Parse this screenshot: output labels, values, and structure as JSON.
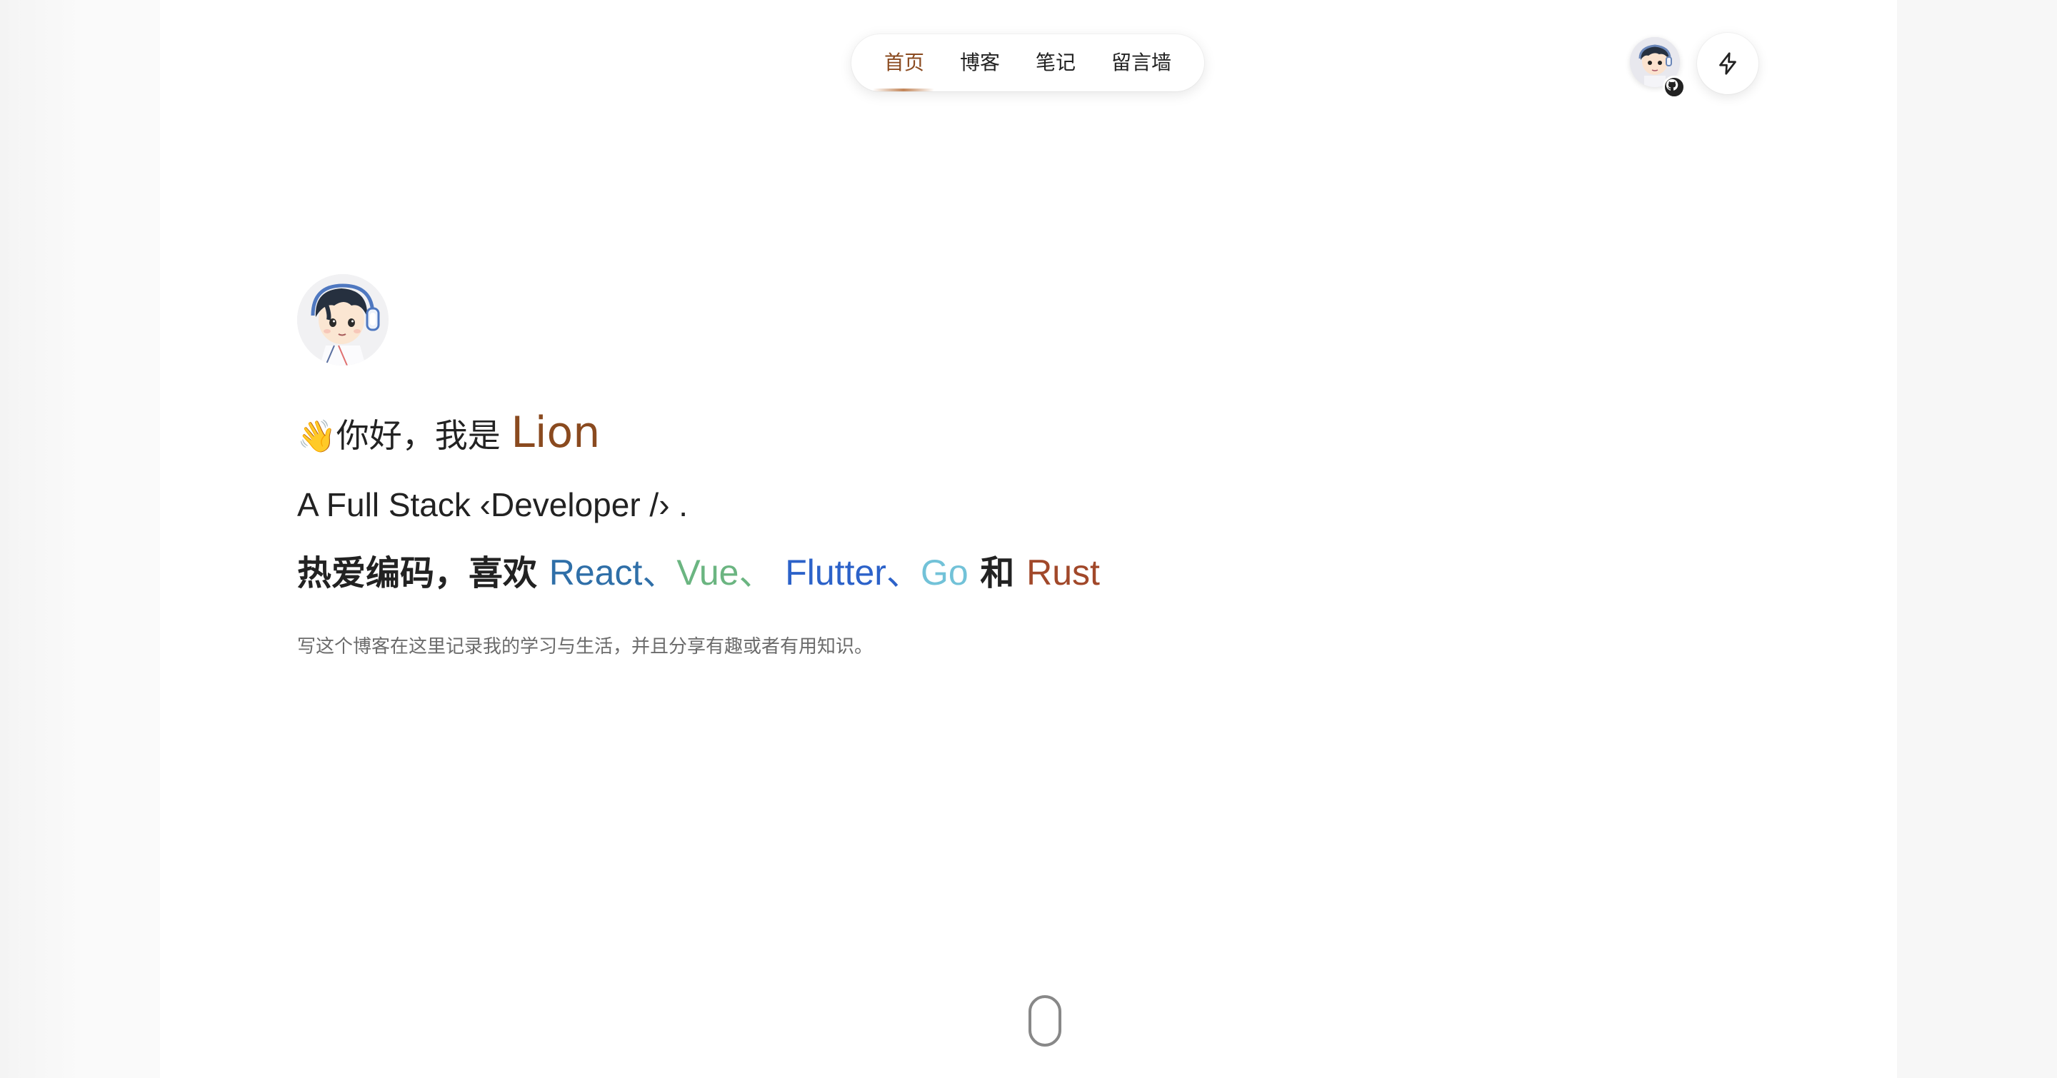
{
  "nav": {
    "items": [
      {
        "label": "首页",
        "active": true
      },
      {
        "label": "博客",
        "active": false
      },
      {
        "label": "笔记",
        "active": false
      },
      {
        "label": "留言墙",
        "active": false
      }
    ]
  },
  "header": {
    "avatar_icon": "avatar-icon",
    "github_icon": "github-icon",
    "theme_icon": "bolt-icon"
  },
  "hero": {
    "greeting_emoji": "👋",
    "greeting": "你好，我是",
    "name": "Lion",
    "subtitle": "A Full Stack ‹Developer /› .",
    "love_prefix": "热爱编码，喜欢",
    "techs": [
      {
        "name": "React",
        "color": "#2f6fa8"
      },
      {
        "name": "Vue",
        "color": "#6bb581"
      },
      {
        "name": "Flutter",
        "color": "#2c62c9"
      },
      {
        "name": "Go",
        "color": "#72c2d8"
      },
      {
        "name": "Rust",
        "color": "#a1482a"
      }
    ],
    "sep1": "、",
    "sep2": "、",
    "sep3": "、",
    "conj": "和",
    "description": "写这个博客在这里记录我的学习与生活，并且分享有趣或者有用知识。"
  },
  "colors": {
    "accent": "#8a4a1f",
    "text": "#222222",
    "muted": "#6b6b6b"
  }
}
